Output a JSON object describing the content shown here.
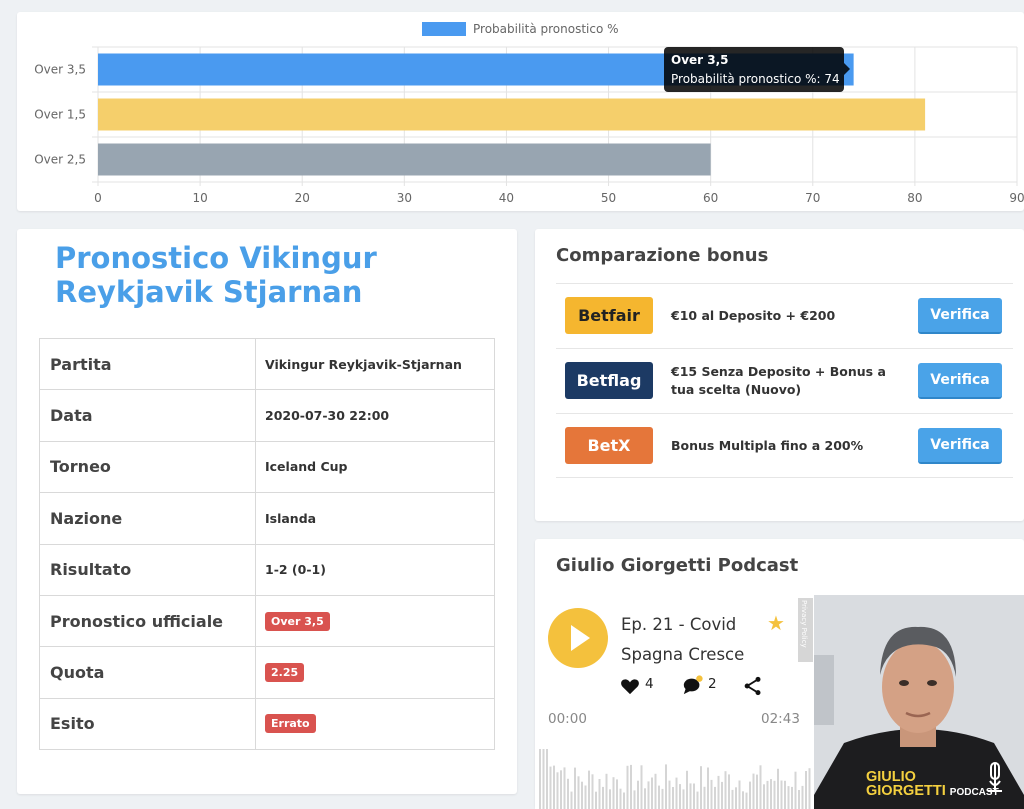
{
  "chart_data": {
    "type": "bar",
    "orientation": "horizontal",
    "categories": [
      "Over 3,5",
      "Over 1,5",
      "Over 2,5"
    ],
    "values": [
      74,
      81,
      60
    ],
    "bar_colors": [
      "#4a9af0",
      "#f5cf6b",
      "#98a5b1"
    ],
    "series": [
      {
        "name": "Probabilità pronostico %",
        "values": [
          74,
          81,
          60
        ]
      }
    ],
    "xlim": [
      0,
      90
    ],
    "xticks": [
      "0",
      "10",
      "20",
      "30",
      "40",
      "50",
      "60",
      "70",
      "80",
      "90"
    ],
    "grid": true,
    "legend": "top",
    "tooltip": {
      "title": "Over 3,5",
      "text": "Probabilità pronostico %: 74"
    }
  },
  "info": {
    "title": "Pronostico Vikingur Reykjavik Stjarnan",
    "rows": [
      {
        "label": "Partita",
        "value": "Vikingur Reykjavik-Stjarnan"
      },
      {
        "label": "Data",
        "value": "2020-07-30 22:00"
      },
      {
        "label": "Torneo",
        "value": "Iceland Cup"
      },
      {
        "label": "Nazione",
        "value": "Islanda"
      },
      {
        "label": "Risultato",
        "value": "1-2 (0-1)"
      },
      {
        "label": "Pronostico ufficiale",
        "badge": "Over 3,5"
      },
      {
        "label": "Quota",
        "badge": "2.25"
      },
      {
        "label": "Esito",
        "badge": "Errato"
      }
    ]
  },
  "bonus": {
    "title": "Comparazione bonus",
    "rows": [
      {
        "brand": "Betfair",
        "offer": "€10 al Deposito + €200",
        "button": "Verifica"
      },
      {
        "brand": "Betflag",
        "offer": "€15 Senza Deposito + Bonus a tua scelta (Nuovo)",
        "button": "Verifica"
      },
      {
        "brand": "BetX",
        "offer": "Bonus Multipla fino a 200%",
        "button": "Verifica"
      }
    ],
    "brand_colors": {
      "betfair": "#f5b62f",
      "betflag": "#1c3a64",
      "betx": "#e5763a"
    }
  },
  "podcast": {
    "title": "Giulio Giorgetti Podcast",
    "episode": "Ep. 21 - Covid Spagna Cresce",
    "likes": "4",
    "comments": "2",
    "time_current": "00:00",
    "time_total": "02:43",
    "privacy_label": "Privacy Policy",
    "brand_line1": "GIULIO",
    "brand_line2": "GIORGETTI",
    "brand_line3": "PODCAST"
  }
}
